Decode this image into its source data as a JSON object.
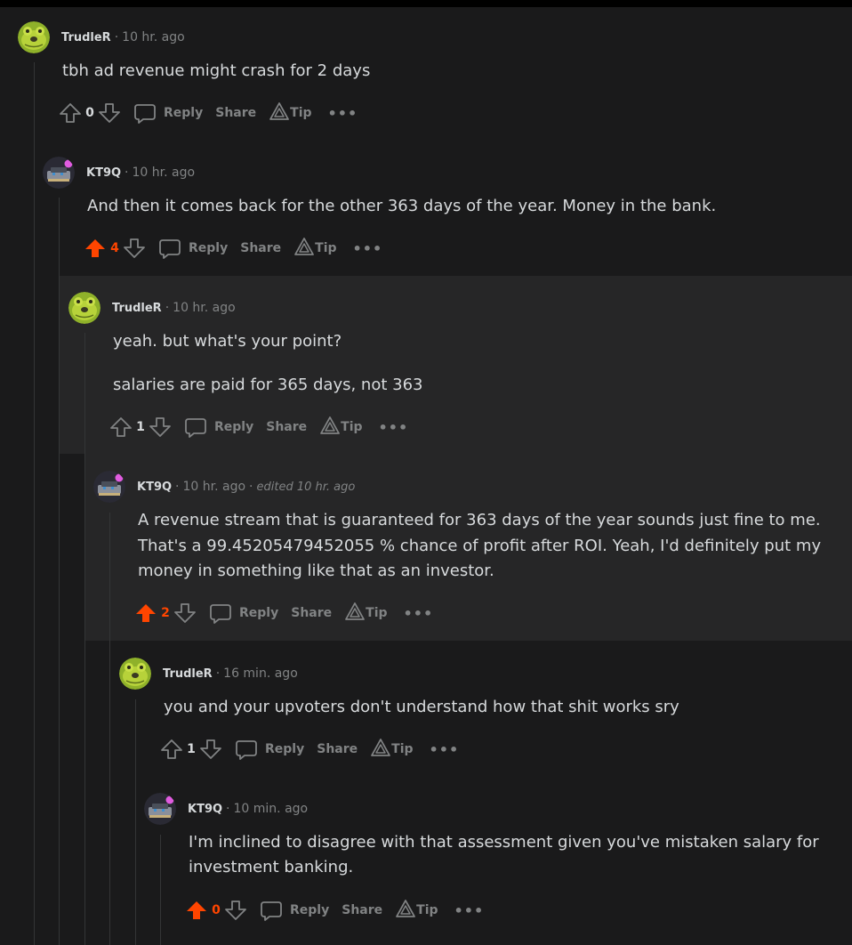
{
  "colors": {
    "upvote_active": "#ff4500",
    "muted": "#818384",
    "text": "#d7dadc",
    "bg": "#1a1a1b",
    "highlight_bg": "#262627"
  },
  "actions": {
    "reply": "Reply",
    "share": "Share",
    "tip": "Tip",
    "more": "•••"
  },
  "comments": [
    {
      "author": "TrudleR",
      "time": "10 hr. ago",
      "edited": "",
      "avatar": "frog-avatar",
      "lines": [
        "tbh ad revenue might crash for 2 days"
      ],
      "score": "0",
      "upvoted": false
    },
    {
      "author": "KT9Q",
      "time": "10 hr. ago",
      "edited": "",
      "avatar": "robot-avatar",
      "lines": [
        "And then it comes back for the other 363 days of the year. Money in the bank."
      ],
      "score": "4",
      "upvoted": true
    },
    {
      "author": "TrudleR",
      "time": "10 hr. ago",
      "edited": "",
      "avatar": "frog-avatar",
      "lines": [
        "yeah. but what's your point?",
        "salaries are paid for 365 days, not 363"
      ],
      "score": "1",
      "upvoted": false
    },
    {
      "author": "KT9Q",
      "time": "10 hr. ago",
      "edited": "edited 10 hr. ago",
      "avatar": "robot-avatar",
      "lines": [
        "A revenue stream that is guaranteed for 363 days of the year sounds just fine to me.",
        "That's a 99.45205479452055 % chance of profit after ROI. Yeah, I'd definitely put my",
        "money in something like that as an investor."
      ],
      "score": "2",
      "upvoted": true
    },
    {
      "author": "TrudleR",
      "time": "16 min. ago",
      "edited": "",
      "avatar": "frog-avatar",
      "lines": [
        "you and your upvoters don't understand how that shit works sry"
      ],
      "score": "1",
      "upvoted": false
    },
    {
      "author": "KT9Q",
      "time": "10 min. ago",
      "edited": "",
      "avatar": "robot-avatar",
      "lines": [
        "I'm inclined to disagree with that assessment given you've mistaken salary for",
        "investment banking."
      ],
      "score": "0",
      "upvoted": true
    }
  ]
}
